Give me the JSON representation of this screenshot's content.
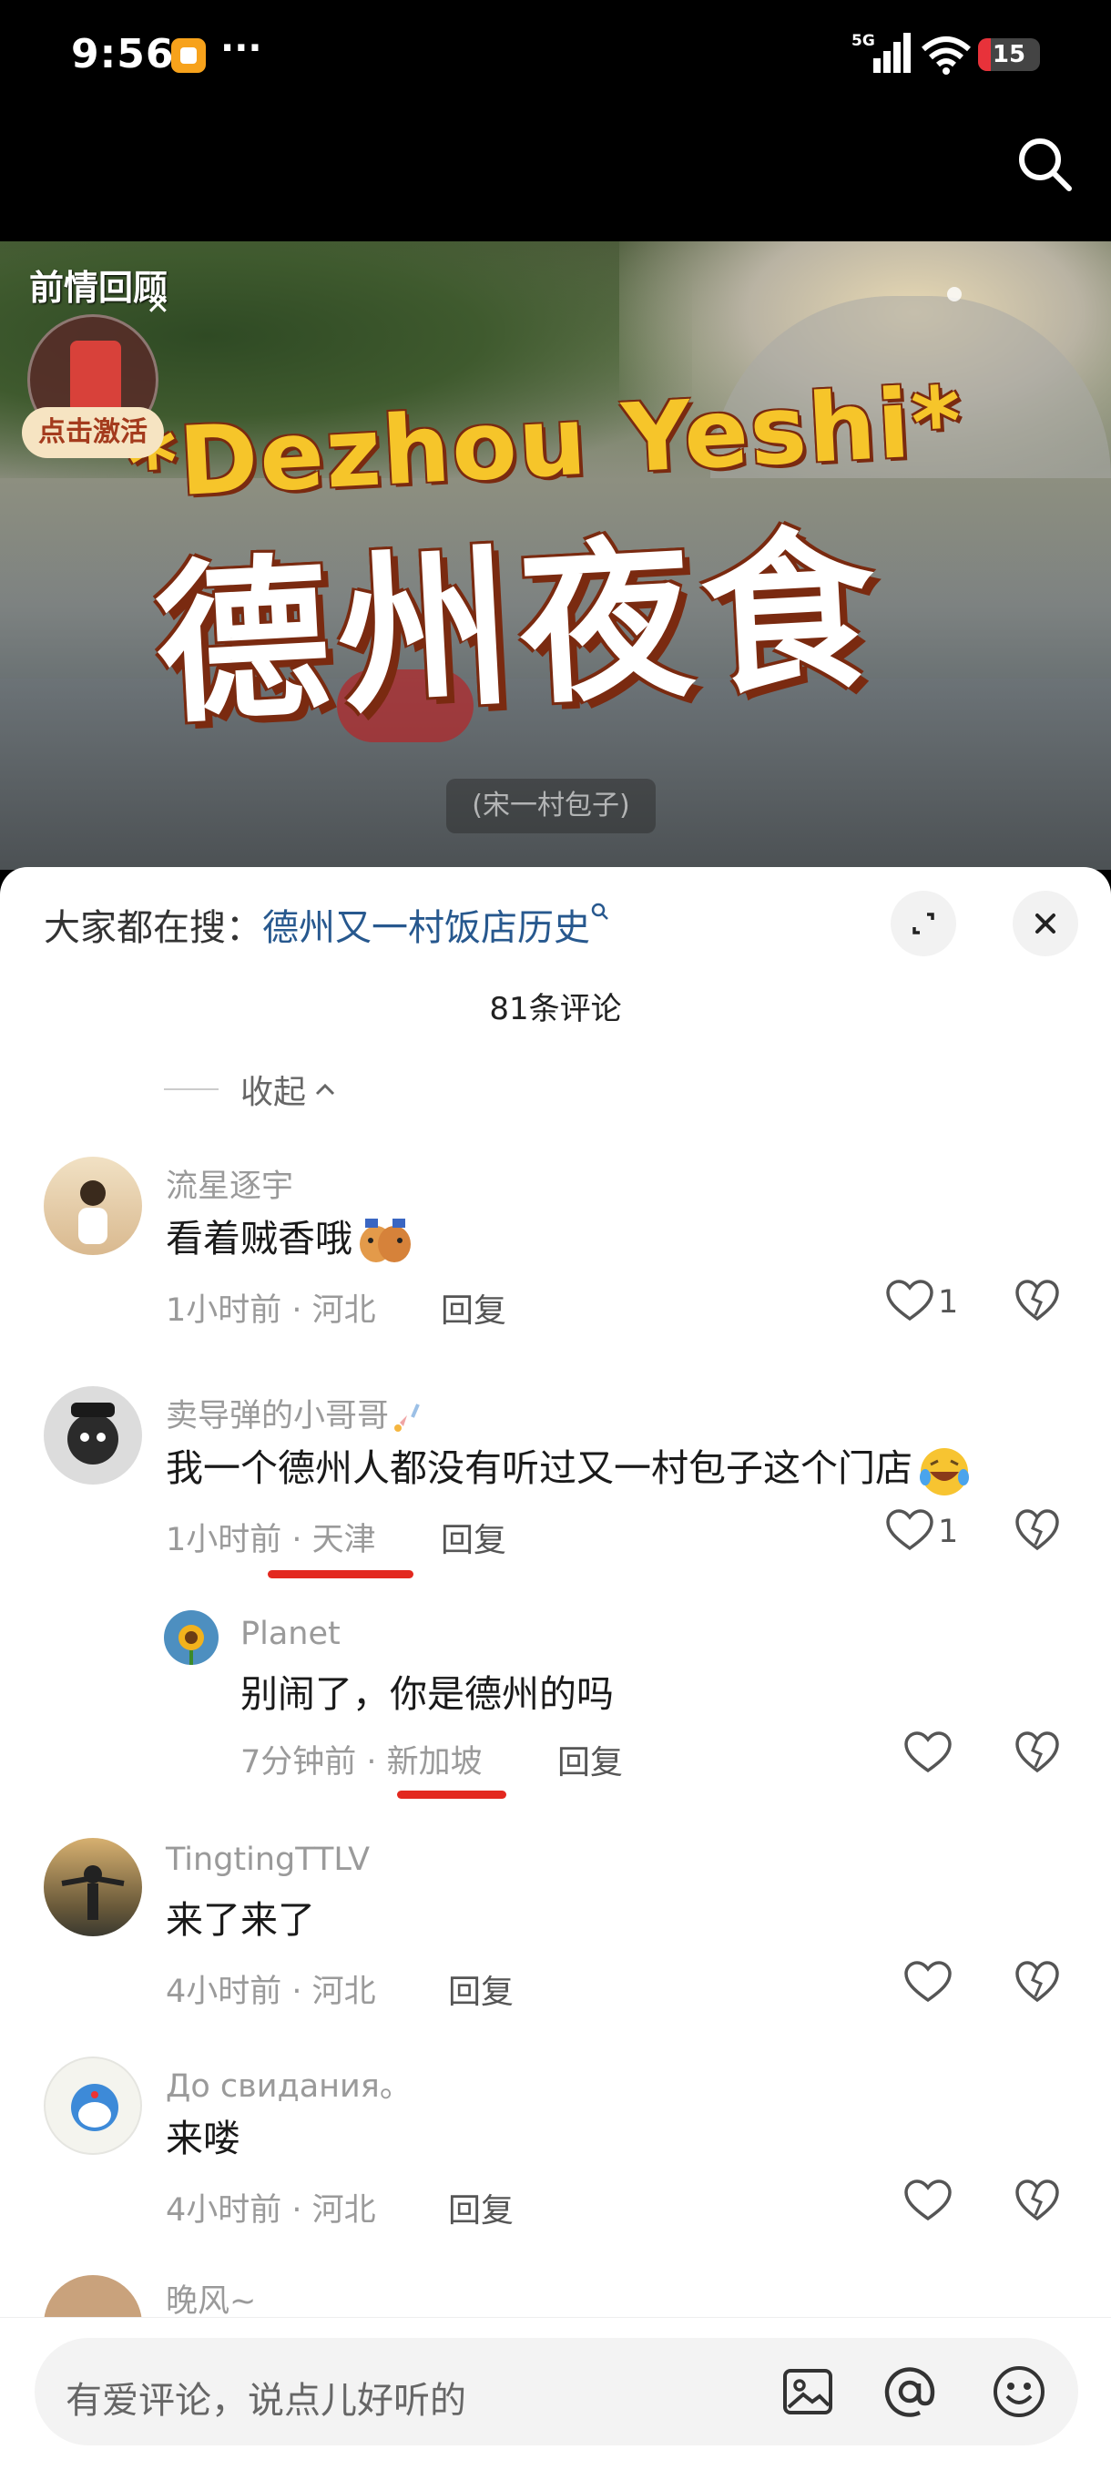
{
  "status_bar": {
    "time": "9:56",
    "dots": "···",
    "network": "5G",
    "battery": "15"
  },
  "video": {
    "recap_label": "前情回顾",
    "activate_label": "点击激活",
    "title_en": "*Dezhou Yeshi*",
    "title_zh": "德州夜食",
    "caption": "(宋一村包子)"
  },
  "panel": {
    "search_label": "大家都在搜：",
    "search_keyword": "德州又一村饭店历史",
    "comment_count": "81条评论",
    "collapse_label": "收起"
  },
  "comments": [
    {
      "name": "流星逐宇",
      "text": "看着贼香哦",
      "time": "1小时前",
      "location": "河北",
      "reply": "回复",
      "likes": "1"
    },
    {
      "name": "卖导弹的小哥哥",
      "text": "我一个德州人都没有听过又一村包子这个门店",
      "time": "1小时前",
      "location": "天津",
      "reply": "回复",
      "likes": "1"
    },
    {
      "name": "Planet",
      "text": "别闹了，你是德州的吗",
      "time": "7分钟前",
      "location": "新加坡",
      "reply": "回复",
      "likes": ""
    },
    {
      "name": "TingtingTTLV",
      "text": "来了来了",
      "time": "4小时前",
      "location": "河北",
      "reply": "回复",
      "likes": ""
    },
    {
      "name": "До свидания。",
      "text": "来喽",
      "time": "4小时前",
      "location": "河北",
      "reply": "回复",
      "likes": ""
    },
    {
      "name": "晚风~"
    }
  ],
  "input": {
    "placeholder": "有爱评论，说点儿好听的"
  },
  "colors": {
    "accent": "#27588e",
    "highlight": "#e3281f"
  }
}
